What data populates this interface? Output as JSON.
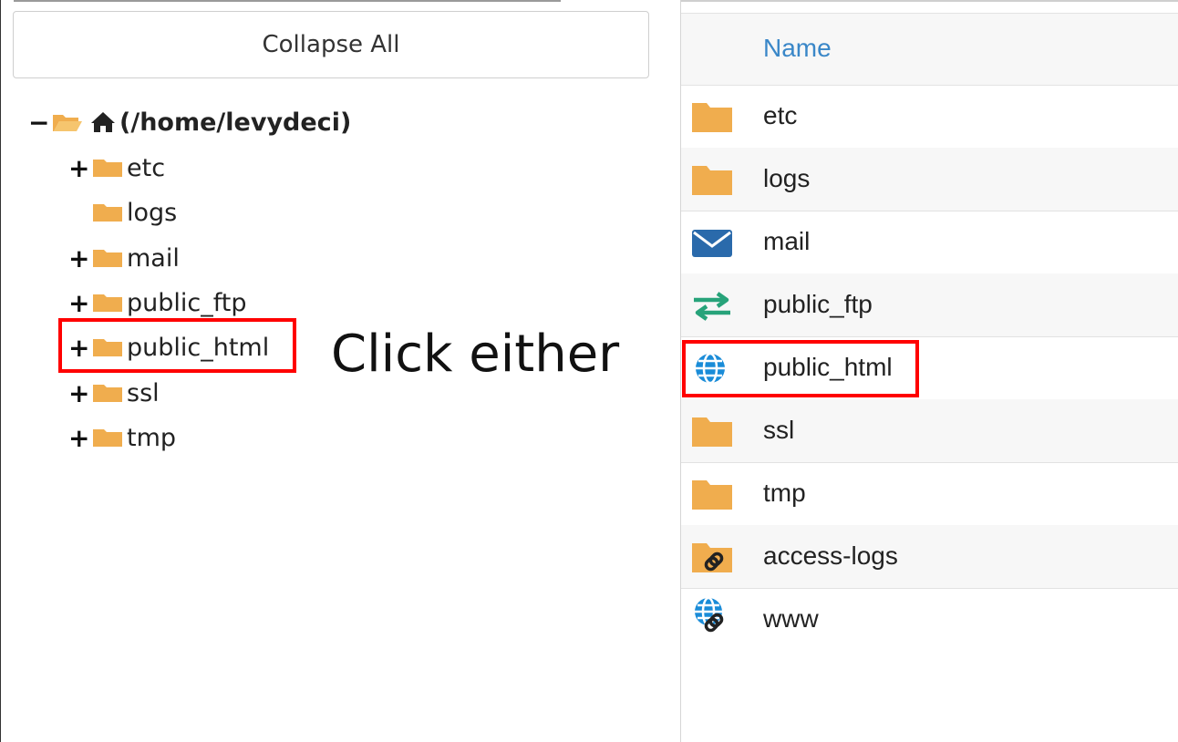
{
  "tree": {
    "collapse_label": "Collapse All",
    "root": {
      "toggle": "−",
      "label": "(/home/levydeci)"
    },
    "items": [
      {
        "toggle": "+",
        "label": "etc"
      },
      {
        "toggle": "",
        "label": "logs"
      },
      {
        "toggle": "+",
        "label": "mail"
      },
      {
        "toggle": "+",
        "label": "public_ftp"
      },
      {
        "toggle": "+",
        "label": "public_html"
      },
      {
        "toggle": "+",
        "label": "ssl"
      },
      {
        "toggle": "+",
        "label": "tmp"
      }
    ]
  },
  "annotation": {
    "text": "Click either",
    "color": "#ff0000"
  },
  "list": {
    "header_name": "Name",
    "rows": [
      {
        "name": "etc",
        "icon": "folder-icon"
      },
      {
        "name": "logs",
        "icon": "folder-icon"
      },
      {
        "name": "mail",
        "icon": "envelope-icon"
      },
      {
        "name": "public_ftp",
        "icon": "transfer-arrows-icon"
      },
      {
        "name": "public_html",
        "icon": "globe-icon"
      },
      {
        "name": "ssl",
        "icon": "folder-icon"
      },
      {
        "name": "tmp",
        "icon": "folder-icon"
      },
      {
        "name": "access-logs",
        "icon": "folder-link-icon"
      },
      {
        "name": "www",
        "icon": "globe-link-icon"
      }
    ]
  },
  "colors": {
    "folder": "#f0ad4e",
    "link_header": "#3a87c8",
    "mail_icon": "#2a6aab",
    "ftp_icon": "#27a37a",
    "globe_icon": "#1a8cd8"
  }
}
